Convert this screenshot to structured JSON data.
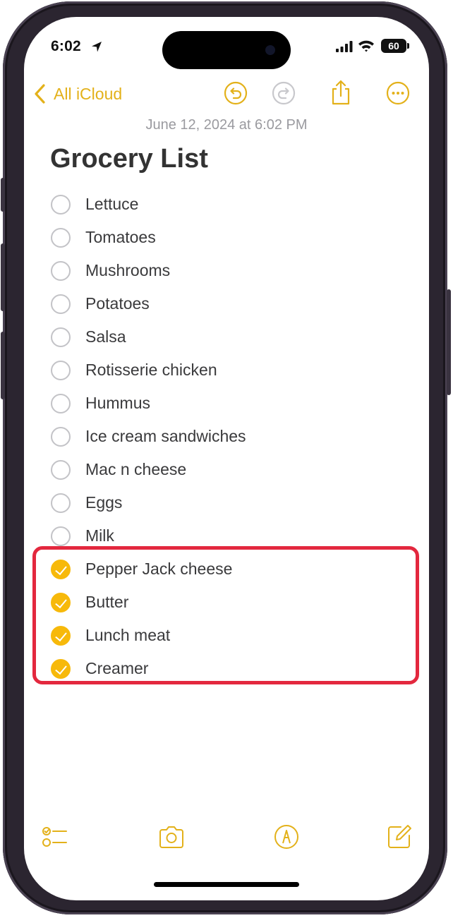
{
  "status_bar": {
    "time": "6:02",
    "battery": "60"
  },
  "nav": {
    "back_label": "All iCloud",
    "icons": [
      "undo-icon",
      "redo-icon",
      "share-icon",
      "more-icon"
    ]
  },
  "note": {
    "date": "June 12, 2024 at 6:02 PM",
    "title": "Grocery List",
    "items": [
      {
        "text": "Lettuce",
        "checked": false
      },
      {
        "text": "Tomatoes",
        "checked": false
      },
      {
        "text": "Mushrooms",
        "checked": false
      },
      {
        "text": "Potatoes",
        "checked": false
      },
      {
        "text": "Salsa",
        "checked": false
      },
      {
        "text": "Rotisserie chicken",
        "checked": false
      },
      {
        "text": "Hummus",
        "checked": false
      },
      {
        "text": "Ice cream sandwiches",
        "checked": false
      },
      {
        "text": "Mac n cheese",
        "checked": false
      },
      {
        "text": "Eggs",
        "checked": false
      },
      {
        "text": "Milk",
        "checked": false
      },
      {
        "text": "Pepper Jack cheese",
        "checked": true
      },
      {
        "text": "Butter",
        "checked": true
      },
      {
        "text": "Lunch meat",
        "checked": true
      },
      {
        "text": "Creamer",
        "checked": true
      }
    ]
  },
  "toolbar": {
    "icons": [
      "checklist-icon",
      "camera-icon",
      "markup-pen-icon",
      "compose-icon"
    ]
  },
  "colors": {
    "accent": "#e3b11a",
    "checked": "#f7b90a",
    "highlight": "#e3283e"
  }
}
